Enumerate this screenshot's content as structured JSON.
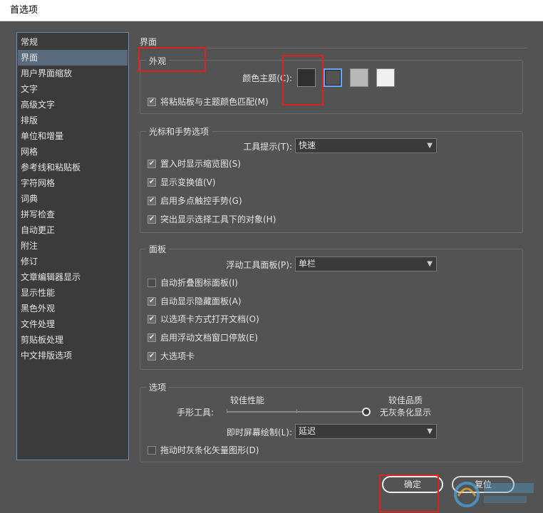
{
  "window": {
    "title": "首选项"
  },
  "sidebar": {
    "items": [
      {
        "label": "常规"
      },
      {
        "label": "界面"
      },
      {
        "label": "用户界面缩放"
      },
      {
        "label": "文字"
      },
      {
        "label": "高级文字"
      },
      {
        "label": "排版"
      },
      {
        "label": "单位和增量"
      },
      {
        "label": "网格"
      },
      {
        "label": "参考线和粘贴板"
      },
      {
        "label": "字符网格"
      },
      {
        "label": "词典"
      },
      {
        "label": "拼写检查"
      },
      {
        "label": "自动更正"
      },
      {
        "label": "附注"
      },
      {
        "label": "修订"
      },
      {
        "label": "文章编辑器显示"
      },
      {
        "label": "显示性能"
      },
      {
        "label": "黑色外观"
      },
      {
        "label": "文件处理"
      },
      {
        "label": "剪贴板处理"
      },
      {
        "label": "中文排版选项"
      }
    ],
    "selected_index": 1
  },
  "main": {
    "title": "界面",
    "appearance": {
      "title": "外观",
      "color_theme_label": "颜色主题(C):",
      "swatch_colors": [
        "#2f2f2f",
        "#535353",
        "#b8b8b8",
        "#f0f0f0"
      ],
      "selected_swatch": 1,
      "match_pasteboard_label": "将粘贴板与主题颜色匹配(M)",
      "match_pasteboard_checked": true
    },
    "cursor": {
      "title": "光标和手势选项",
      "tooltips_label": "工具提示(T):",
      "tooltips_value": "快速",
      "options": [
        {
          "label": "置入时显示缩览图(S)",
          "checked": true
        },
        {
          "label": "显示变换值(V)",
          "checked": true
        },
        {
          "label": "启用多点触控手势(G)",
          "checked": true
        },
        {
          "label": "突出显示选择工具下的对象(H)",
          "checked": true
        }
      ]
    },
    "panels": {
      "title": "面板",
      "floating_tools_label": "浮动工具面板(P):",
      "floating_tools_value": "单栏",
      "options": [
        {
          "label": "自动折叠图标面板(I)",
          "checked": false
        },
        {
          "label": "自动显示隐藏面板(A)",
          "checked": true
        },
        {
          "label": "以选项卡方式打开文档(O)",
          "checked": true
        },
        {
          "label": "启用浮动文档窗口停放(E)",
          "checked": true
        },
        {
          "label": "大选项卡",
          "checked": true
        }
      ]
    },
    "options_group": {
      "title": "选项",
      "hand_tool_label": "手形工具:",
      "better_performance": "较佳性能",
      "better_quality": "较佳品质",
      "no_greeking": "无灰条化显示",
      "slider_value_fraction": 1.0,
      "live_draw_label": "即时屏幕绘制(L):",
      "live_draw_value": "延迟",
      "greek_vector_label": "拖动时灰条化矢量图形(D)",
      "greek_vector_checked": false
    }
  },
  "footer": {
    "ok_label": "确定",
    "cancel_label": "复位"
  },
  "icons": {
    "checkmark": "checkmark-icon",
    "dropdown": "chevron-down-icon"
  }
}
